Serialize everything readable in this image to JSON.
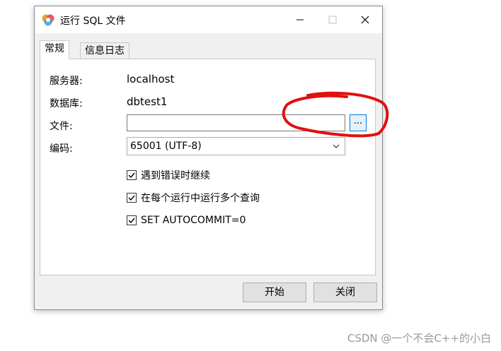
{
  "window": {
    "title": "运行 SQL 文件",
    "icon": "navicat-app-icon",
    "controls": {
      "minimize": "minimize-icon",
      "maximize": "maximize-icon",
      "close": "close-icon"
    }
  },
  "tabs": [
    {
      "label": "常规",
      "active": true
    },
    {
      "label": "信息日志",
      "active": false
    }
  ],
  "form": {
    "server_label": "服务器:",
    "server_value": "localhost",
    "database_label": "数据库:",
    "database_value": "dbtest1",
    "file_label": "文件:",
    "file_value": "",
    "browse_label": "...",
    "encoding_label": "编码:",
    "encoding_value": "65001 (UTF-8)"
  },
  "options": [
    {
      "label": "遇到错误时继续",
      "checked": true
    },
    {
      "label": "在每个运行中运行多个查询",
      "checked": true
    },
    {
      "label": "SET AUTOCOMMIT=0",
      "checked": true
    }
  ],
  "buttons": {
    "start": "开始",
    "close": "关闭"
  },
  "annotation": {
    "color": "#e01010"
  },
  "watermark": "CSDN @一个不会C++的小白"
}
